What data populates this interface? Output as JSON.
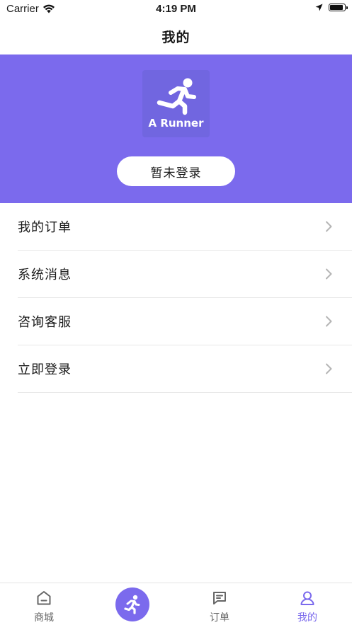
{
  "status_bar": {
    "carrier": "Carrier",
    "time": "4:19 PM",
    "battery_level": 0.9
  },
  "nav": {
    "title": "我的"
  },
  "profile": {
    "logo_text": "A Runner",
    "login_button_label": "暂未登录",
    "background_color": "#7b6aed"
  },
  "menu": {
    "items": [
      {
        "label": "我的订单"
      },
      {
        "label": "系统消息"
      },
      {
        "label": "咨询客服"
      },
      {
        "label": "立即登录"
      }
    ]
  },
  "tab_bar": {
    "accent_color": "#7b6aed",
    "tabs": [
      {
        "label": "商城",
        "icon": "home-icon"
      },
      {
        "label": "",
        "icon": "runner-icon"
      },
      {
        "label": "订单",
        "icon": "order-icon"
      },
      {
        "label": "我的",
        "icon": "profile-icon",
        "active": true
      }
    ]
  }
}
